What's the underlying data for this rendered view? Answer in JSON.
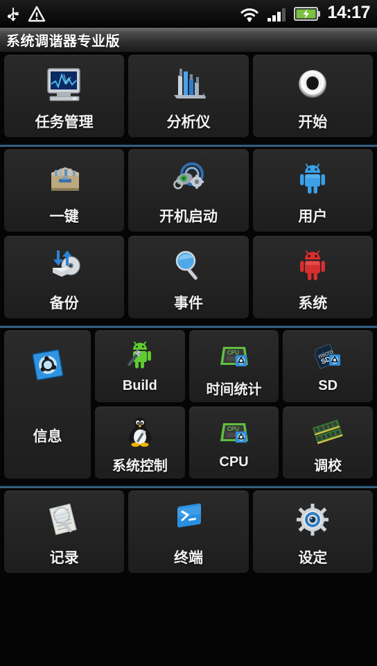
{
  "status_bar": {
    "icons_left": [
      "usb-icon",
      "warning-triangle-icon"
    ],
    "icons_right": [
      "wifi-icon",
      "signal-bars-icon",
      "battery-charging-icon"
    ],
    "time": "14:17"
  },
  "title_bar": {
    "title": "系统调谐器专业版"
  },
  "colors": {
    "tile_bg": "#232323",
    "page_bg": "#050505",
    "divider_accent": "#4e86ad",
    "label_text": "#f2f2f2",
    "battery_green": "#7ac143"
  },
  "groups": [
    {
      "name": "group-1",
      "rows": [
        {
          "tiles": [
            {
              "label": "任务管理",
              "icon": "monitor-waveform-icon"
            },
            {
              "label": "分析仪",
              "icon": "bar-chart-icon"
            },
            {
              "label": "开始",
              "icon": "power-ring-icon"
            }
          ]
        }
      ]
    },
    {
      "name": "group-2",
      "rows": [
        {
          "tiles": [
            {
              "label": "一键",
              "icon": "toolbox-icon"
            },
            {
              "label": "开机启动",
              "icon": "boot-gears-icon"
            },
            {
              "label": "用户",
              "icon": "android-blue-icon"
            }
          ]
        },
        {
          "tiles": [
            {
              "label": "备份",
              "icon": "disk-backup-icon"
            },
            {
              "label": "事件",
              "icon": "magnifier-blue-icon"
            },
            {
              "label": "系统",
              "icon": "android-red-icon"
            }
          ]
        }
      ]
    },
    {
      "name": "group-3",
      "tall_tile": {
        "label": "信息",
        "icon": "ubuntu-blue-square-icon"
      },
      "subrows": [
        {
          "tiles": [
            {
              "label": "Build",
              "icon": "android-wrench-icon"
            },
            {
              "label": "时间统计",
              "icon": "cpu-chip-icon"
            },
            {
              "label": "SD",
              "icon": "microsd-card-icon"
            }
          ]
        },
        {
          "tiles": [
            {
              "label": "系统控制",
              "icon": "tux-penguin-icon"
            },
            {
              "label": "CPU",
              "icon": "cpu-chip-icon"
            },
            {
              "label": "调校",
              "icon": "ram-modules-icon"
            }
          ]
        }
      ]
    },
    {
      "name": "group-4",
      "rows": [
        {
          "tiles": [
            {
              "label": "记录",
              "icon": "document-magnifier-icon"
            },
            {
              "label": "终端",
              "icon": "terminal-prompt-icon"
            },
            {
              "label": "设定",
              "icon": "gear-eye-icon"
            }
          ]
        }
      ]
    }
  ]
}
